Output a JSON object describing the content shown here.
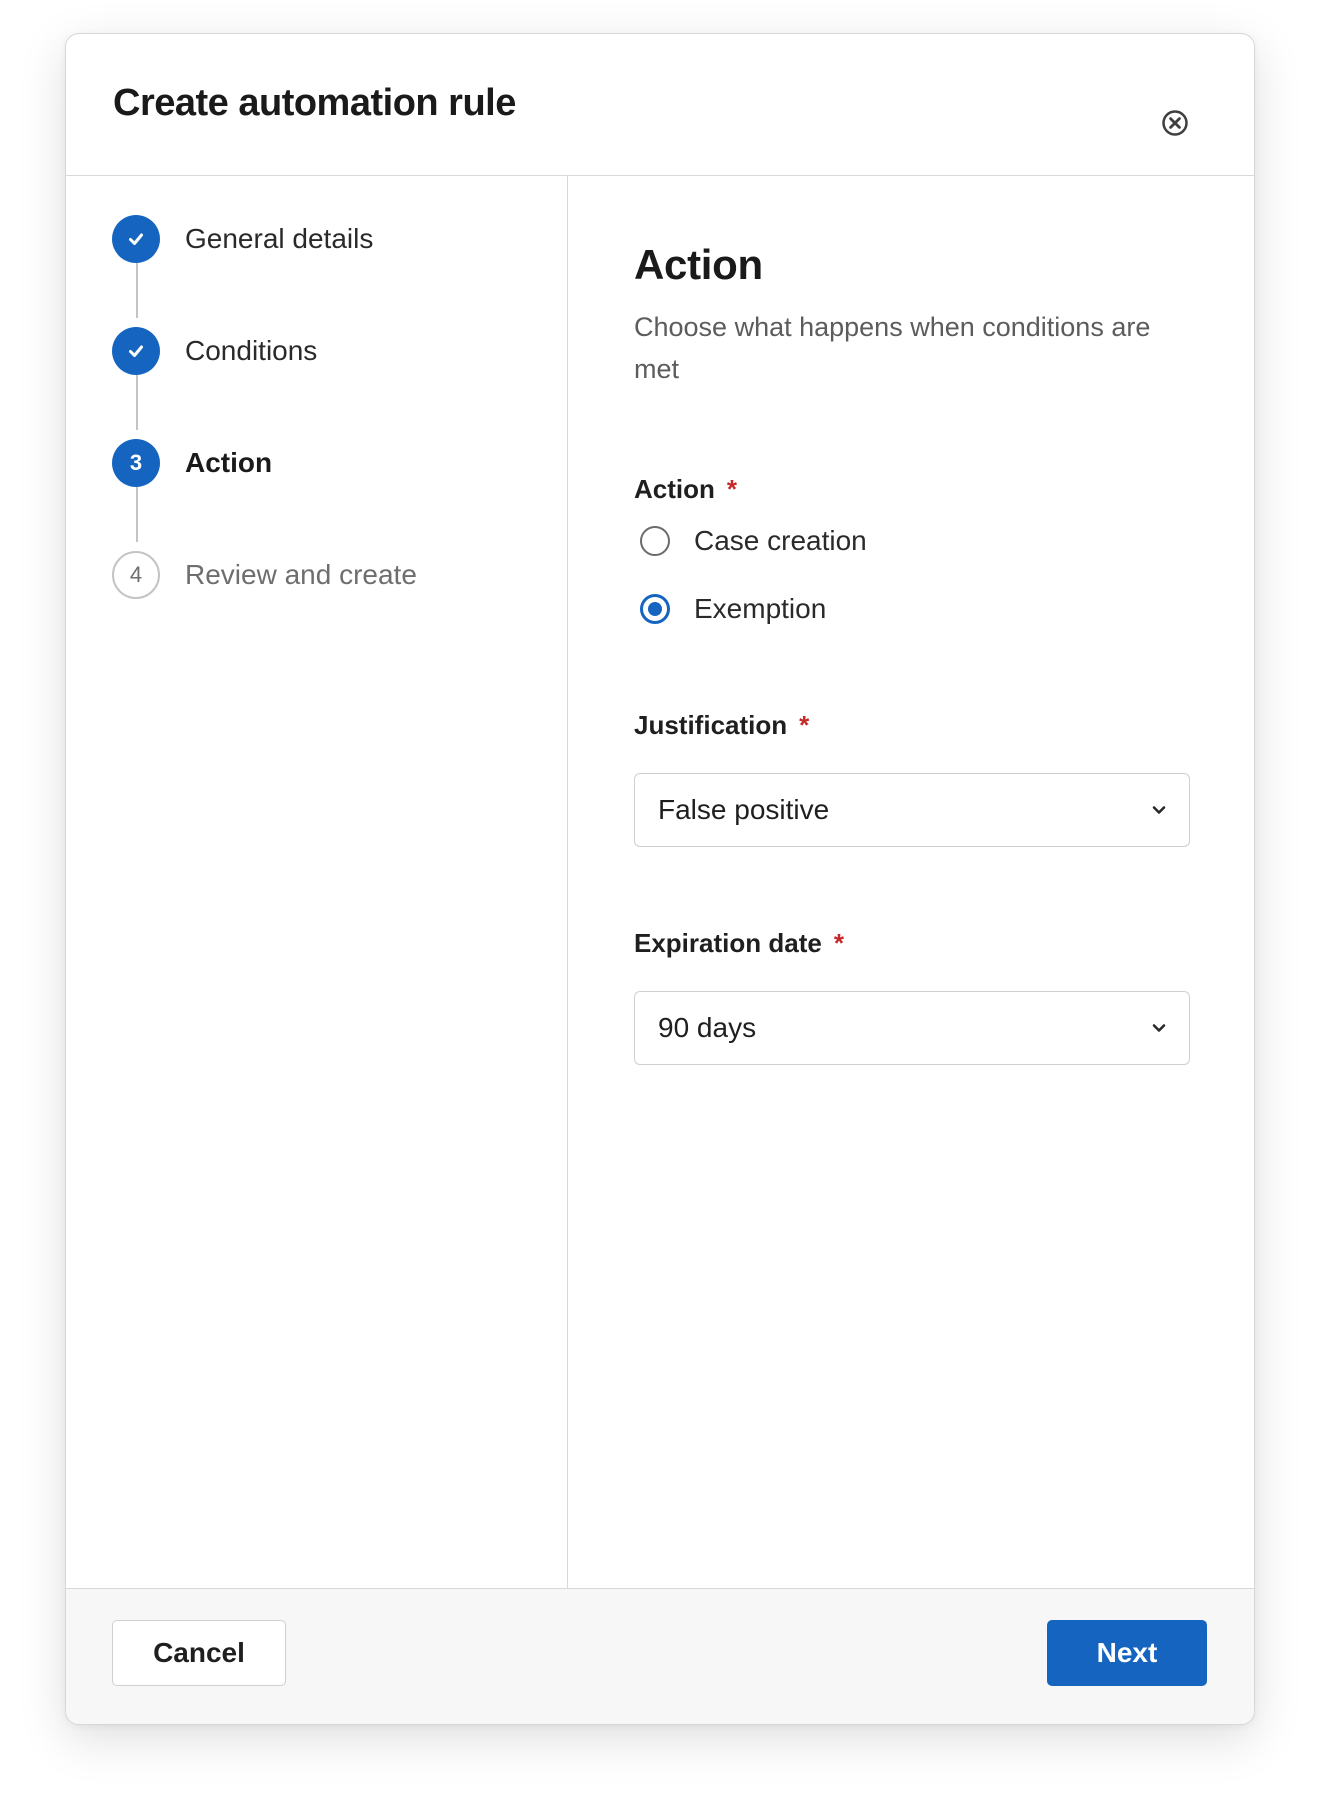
{
  "modal": {
    "title": "Create automation rule",
    "close_icon": "close-circle-icon"
  },
  "stepper": {
    "steps": [
      {
        "number": "1",
        "label": "General details",
        "state": "completed",
        "icon": "check-icon"
      },
      {
        "number": "2",
        "label": "Conditions",
        "state": "completed",
        "icon": "check-icon"
      },
      {
        "number": "3",
        "label": "Action",
        "state": "current"
      },
      {
        "number": "4",
        "label": "Review and create",
        "state": "upcoming"
      }
    ]
  },
  "content": {
    "title": "Action",
    "subtitle": "Choose what happens when conditions are met",
    "action_field": {
      "label": "Action",
      "required_mark": "*",
      "options": [
        {
          "label": "Case creation",
          "checked": false
        },
        {
          "label": "Exemption",
          "checked": true
        }
      ]
    },
    "justification_field": {
      "label": "Justification",
      "required_mark": "*",
      "value": "False positive"
    },
    "expiration_field": {
      "label": "Expiration date",
      "required_mark": "*",
      "value": "90 days"
    }
  },
  "footer": {
    "cancel_label": "Cancel",
    "next_label": "Next"
  },
  "colors": {
    "accent": "#1565c0",
    "required": "#c62828",
    "border": "#d9d9d9",
    "footer_bg": "#f7f7f7",
    "muted_text": "#6e6e6e"
  }
}
